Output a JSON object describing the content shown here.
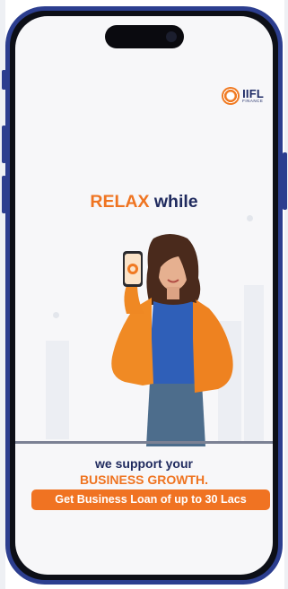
{
  "brand": {
    "logo_text": "IIFL",
    "logo_subtext": "FINANCE"
  },
  "ad": {
    "headline_part1": "RELAX",
    "headline_part2": " while",
    "tagline_line1": "we support your",
    "tagline_line2": "BUSINESS GROWTH.",
    "cta_label": "Get Business Loan of up to 30 Lacs"
  },
  "colors": {
    "frame": "#2c3e8f",
    "accent": "#ef7421",
    "navy": "#1f2a5e"
  }
}
